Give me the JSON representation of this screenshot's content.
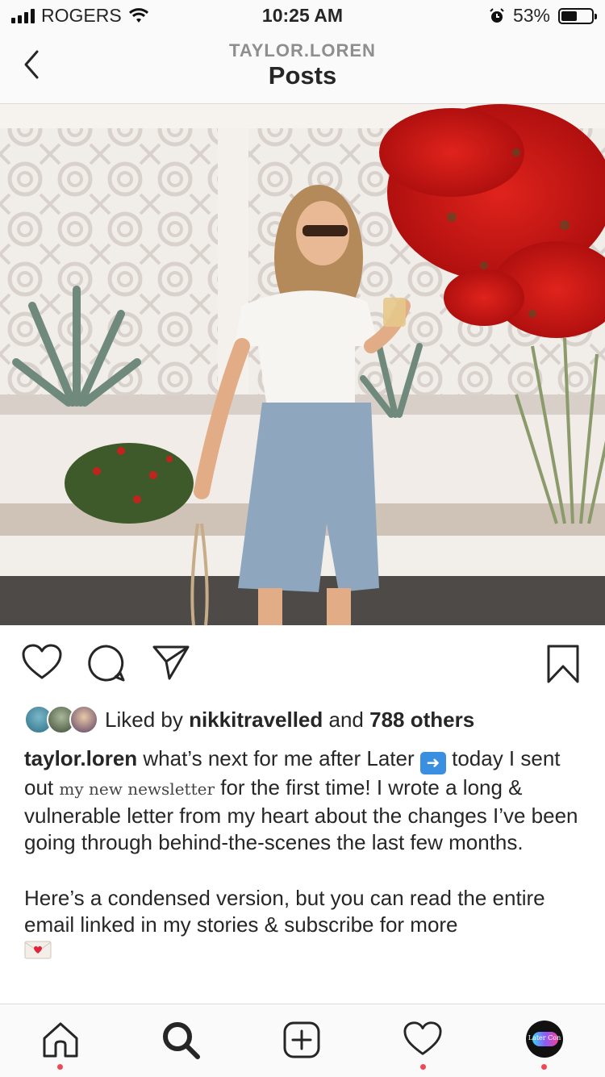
{
  "status_bar": {
    "carrier": "ROGERS",
    "time": "10:25 AM",
    "battery": "53%",
    "battery_level": 0.53
  },
  "header": {
    "username": "TAYLOR.LOREN",
    "title": "Posts"
  },
  "post": {
    "likes": {
      "prefix": "Liked by",
      "user": "nikkitravelled",
      "middle": "and",
      "others": "788 others"
    },
    "caption": {
      "username": "taylor.loren",
      "text_1": "what’s next for me after Later",
      "text_2": "today I sent out",
      "link_text": "my new newsletter",
      "text_3": "for the first time! I wrote a long & vulnerable letter from my heart about the changes I’ve been going through behind-the-scenes the last few months.",
      "paragraph_2": "Here’s a condensed version, but you can read the entire email linked in my stories & subscribe for more"
    }
  },
  "icons": {
    "back": "chevron-left-icon",
    "like": "heart-icon",
    "comment": "comment-icon",
    "share": "paper-plane-icon",
    "save": "bookmark-icon",
    "home": "home-icon",
    "search": "search-icon",
    "new_post": "plus-square-icon",
    "activity": "heart-icon",
    "profile": "avatar"
  },
  "profile_avatar_label": "Later Con",
  "colors": {
    "notification_dot": "#ed4956",
    "text": "#262626",
    "muted": "#8e8e8e"
  }
}
